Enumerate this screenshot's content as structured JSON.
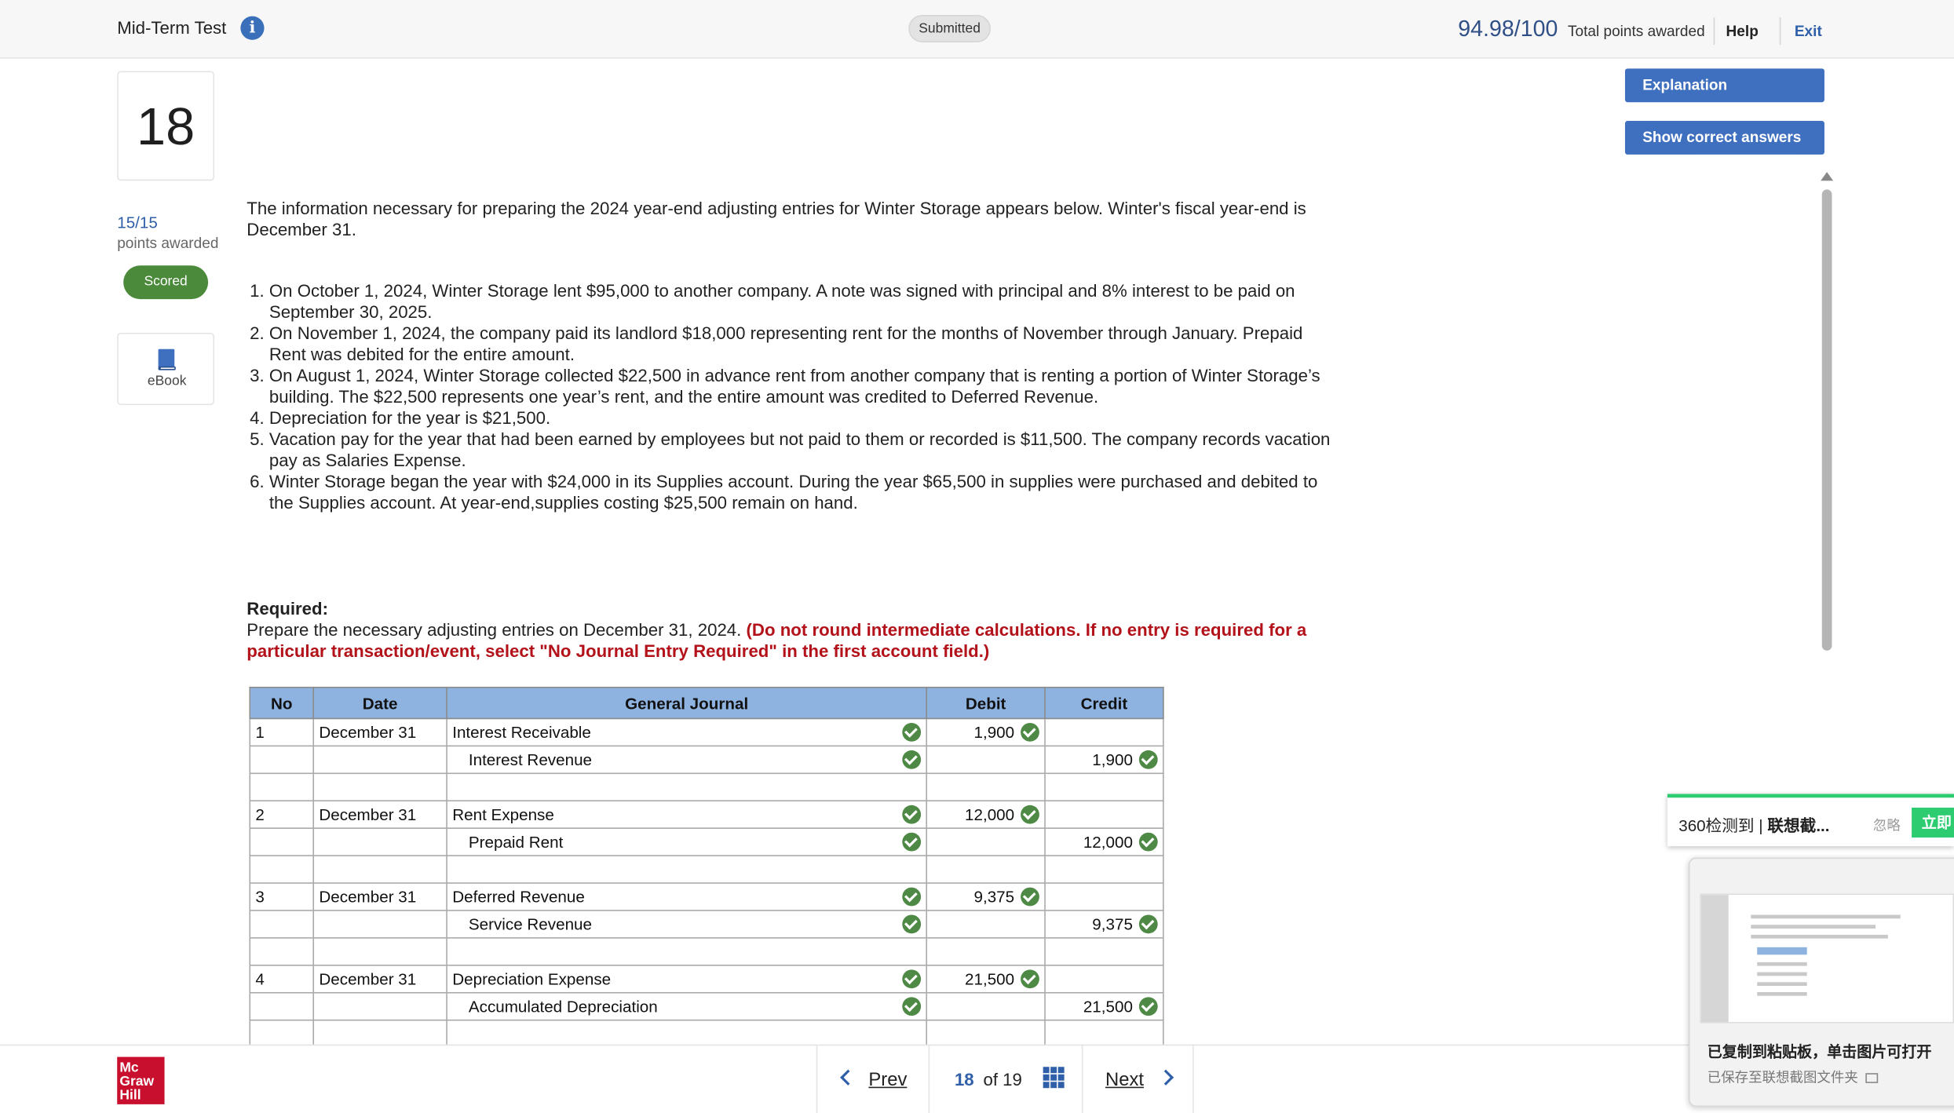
{
  "header": {
    "title": "Mid-Term Test",
    "status": "Submitted",
    "total_score": "94.98/100",
    "total_label": "Total points awarded",
    "help": "Help",
    "exit": "Exit"
  },
  "question": {
    "number": "18",
    "points": "15/15",
    "points_label": "points awarded",
    "scored": "Scored",
    "ebook": "eBook",
    "intro": "The information necessary for preparing the 2024 year-end adjusting entries for Winter Storage appears below. Winter's fiscal year-end is December 31.",
    "items": [
      "On October 1, 2024, Winter Storage lent $95,000 to another company. A note was signed with principal and 8% interest to be paid on September 30, 2025.",
      "On November 1, 2024, the company paid its landlord $18,000 representing rent for the months of November through January. Prepaid Rent was debited for the entire amount.",
      "On August 1, 2024, Winter Storage collected $22,500 in advance rent from another company that is renting a portion of Winter Storage’s building. The $22,500 represents one year’s rent, and the entire amount was credited to Deferred Revenue.",
      "Depreciation for the year is $21,500.",
      "Vacation pay for the year that had been earned by employees but not paid to them or recorded is $11,500. The company records vacation pay as Salaries Expense.",
      "Winter Storage began the year with $24,000 in its Supplies account. During the year $65,500 in supplies were purchased and debited to the Supplies account. At year-end,supplies costing $25,500 remain on hand."
    ],
    "required_head": "Required:",
    "required_text": "Prepare the necessary adjusting entries on December 31, 2024. ",
    "required_note": "(Do not round intermediate calculations. If no entry is required for a particular transaction/event, select \"No Journal Entry Required\" in the first account field.)"
  },
  "buttons": {
    "explanation": "Explanation",
    "show_answers": "Show correct answers"
  },
  "journal": {
    "headers": [
      "No",
      "Date",
      "General Journal",
      "Debit",
      "Credit"
    ],
    "rows": [
      {
        "no": "1",
        "date": "December 31",
        "account": "Interest Receivable",
        "debit": "1,900",
        "credit": ""
      },
      {
        "no": "",
        "date": "",
        "account": "Interest Revenue",
        "debit": "",
        "credit": "1,900"
      },
      {
        "no": "2",
        "date": "December 31",
        "account": "Rent Expense",
        "debit": "12,000",
        "credit": ""
      },
      {
        "no": "",
        "date": "",
        "account": "Prepaid Rent",
        "debit": "",
        "credit": "12,000"
      },
      {
        "no": "3",
        "date": "December 31",
        "account": "Deferred Revenue",
        "debit": "9,375",
        "credit": ""
      },
      {
        "no": "",
        "date": "",
        "account": "Service Revenue",
        "debit": "",
        "credit": "9,375"
      },
      {
        "no": "4",
        "date": "December 31",
        "account": "Depreciation Expense",
        "debit": "21,500",
        "credit": ""
      },
      {
        "no": "",
        "date": "",
        "account": "Accumulated Depreciation",
        "debit": "",
        "credit": "21,500"
      }
    ]
  },
  "footer": {
    "logo": [
      "Mc",
      "Graw",
      "Hill"
    ],
    "prev": "Prev",
    "next": "Next",
    "current_page": "18",
    "of": "of",
    "total_pages": "19"
  },
  "overlay": {
    "toast_prefix": "360检测到 | ",
    "toast_bold": "联想截...",
    "toast_ignore": "忽略",
    "toast_button": "立即",
    "card_title": "已复制到粘贴板，单击图片可打开",
    "card_sub": "已保存至联想截图文件夹"
  },
  "colors": {
    "accent_blue": "#3f6fbf",
    "score_green": "#4a8a3a",
    "check_green": "#4e8a45",
    "table_header": "#8fb3e0",
    "warning_red": "#b3121a",
    "logo_red": "#c8102e"
  },
  "icons": {
    "info": "info-icon",
    "ebook": "book-icon",
    "check": "checkmark-circle-icon",
    "prev": "chevron-left-icon",
    "next": "chevron-right-icon",
    "grid": "grid-icon"
  }
}
